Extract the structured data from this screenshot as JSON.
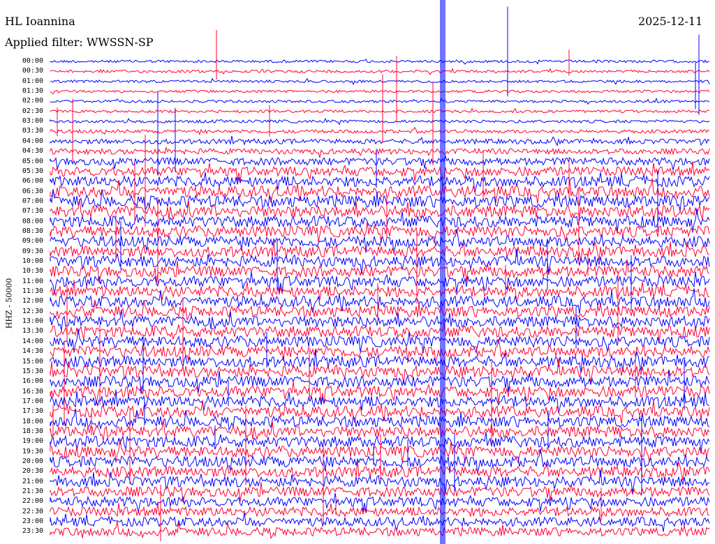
{
  "header": {
    "station": "HL Ioannina",
    "date": "2025-12-11",
    "filter": "Applied filter: WWSSN-SP"
  },
  "chart_data": {
    "type": "line",
    "title": "HL Ioannina",
    "ylabel": "HHZ - 50000",
    "colors": [
      "#0000ff",
      "#ff0033"
    ],
    "row_labels": [
      "00:00",
      "00:30",
      "01:00",
      "01:30",
      "02:00",
      "02:30",
      "03:00",
      "03:30",
      "04:00",
      "04:30",
      "05:00",
      "05:30",
      "06:00",
      "06:30",
      "07:00",
      "07:30",
      "08:00",
      "08:30",
      "09:00",
      "09:30",
      "10:00",
      "10:30",
      "11:00",
      "11:30",
      "12:00",
      "12:30",
      "13:00",
      "13:30",
      "14:00",
      "14:30",
      "15:00",
      "15:30",
      "16:00",
      "16:30",
      "17:00",
      "17:30",
      "18:00",
      "18:30",
      "19:00",
      "19:30",
      "20:00",
      "20:30",
      "21:00",
      "21:30",
      "22:00",
      "22:30",
      "23:00",
      "23:30"
    ],
    "row_noise_level": [
      0.08,
      0.08,
      0.07,
      0.07,
      0.07,
      0.08,
      0.1,
      0.14,
      0.25,
      0.3,
      0.45,
      0.6,
      0.7,
      0.75,
      0.8,
      0.8,
      0.75,
      0.75,
      0.72,
      0.72,
      0.72,
      0.72,
      0.72,
      0.72,
      0.74,
      0.74,
      0.74,
      0.74,
      0.74,
      0.74,
      0.74,
      0.74,
      0.74,
      0.74,
      0.74,
      0.74,
      0.74,
      0.74,
      0.74,
      0.74,
      0.74,
      0.7,
      0.68,
      0.65,
      0.62,
      0.6,
      0.58,
      0.55
    ]
  }
}
